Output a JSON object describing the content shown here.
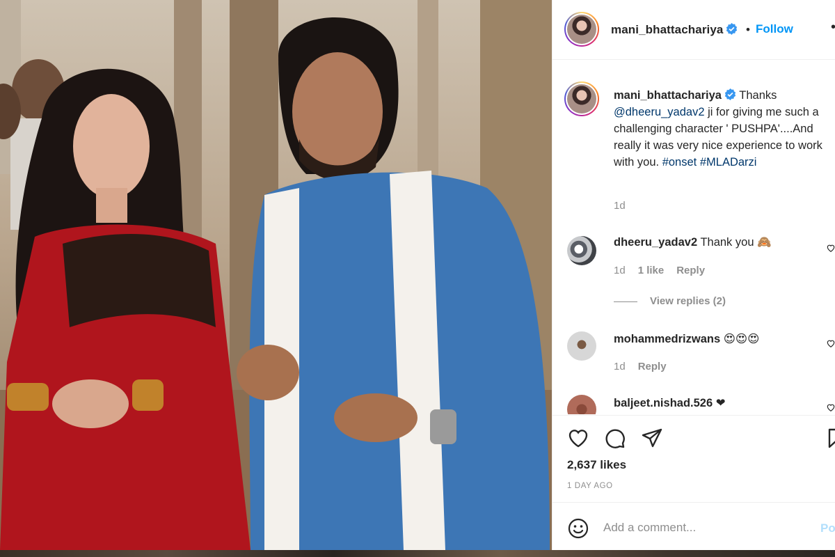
{
  "post": {
    "username": "mani_bhattachariya",
    "verified": true,
    "follow_label": "Follow",
    "separator": "•",
    "more_label": "•••"
  },
  "caption": {
    "username": "mani_bhattachariya",
    "text_before": "Thanks ",
    "mention": "@dheeru_yadav2",
    "text_middle": " ji for giving me such a challenging character ' PUSHPA'....And really it was very nice experience to work with you. ",
    "hashtag1": "#onset",
    "hashtag2": "#MLADarzi",
    "time": "1d"
  },
  "comments": [
    {
      "username": "dheeru_yadav2",
      "text": "Thank you 🙈",
      "time": "1d",
      "likes": "1 like",
      "reply_label": "Reply",
      "view_replies": "View replies (2)"
    },
    {
      "username": "mohammedrizwans",
      "text": "😍😍😍",
      "time": "1d",
      "reply_label": "Reply"
    },
    {
      "username": "baljeet.nishad.526",
      "text": "❤"
    }
  ],
  "actions": {
    "like_icon": "heart-icon",
    "comment_icon": "comment-bubble-icon",
    "share_icon": "paper-plane-icon",
    "save_icon": "bookmark-icon"
  },
  "likes_text": "2,637 likes",
  "date_text": "1 DAY AGO",
  "add_comment": {
    "placeholder": "Add a comment...",
    "post_label": "Post"
  },
  "colors": {
    "follow_blue": "#0095f6",
    "verified_blue": "#3897f0",
    "link_navy": "#00376b",
    "muted_gray": "#8e8e8e"
  }
}
